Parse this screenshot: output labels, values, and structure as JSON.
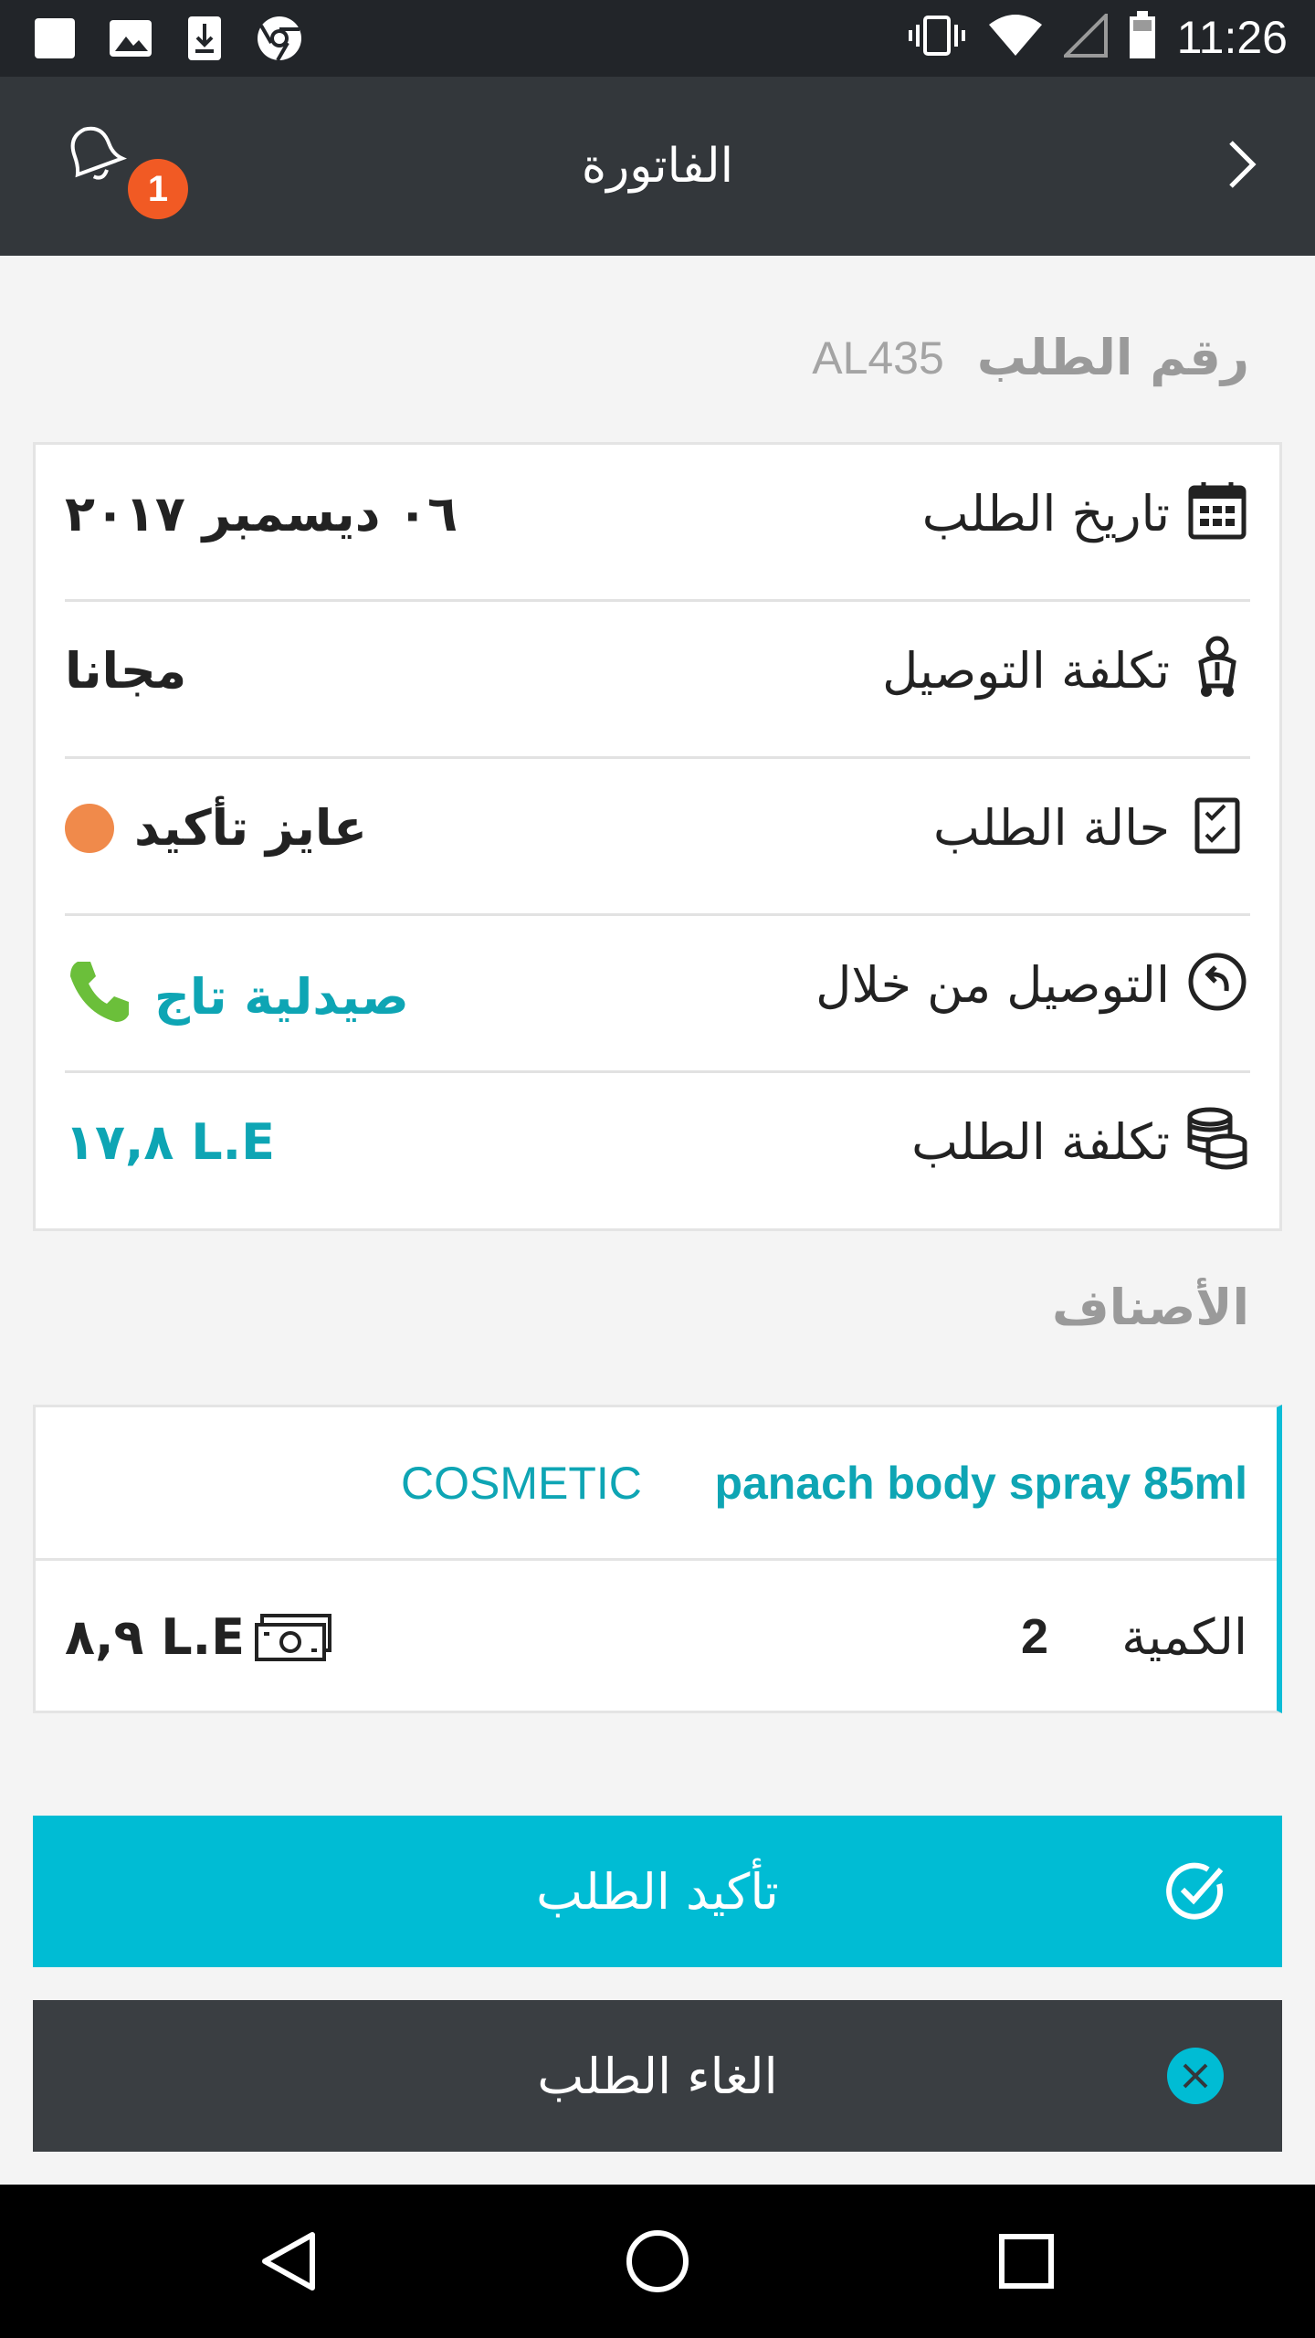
{
  "status_bar": {
    "time": "11:26",
    "icons": [
      "notification-square-icon",
      "image-icon",
      "download-icon",
      "chrome-icon",
      "vibrate-icon",
      "wifi-icon",
      "signal-icon",
      "battery-icon"
    ]
  },
  "app_bar": {
    "title": "الفاتورة",
    "notification_count": "1",
    "back_icon": "chevron-right-icon",
    "bell_icon": "bell-icon"
  },
  "order": {
    "number_label": "رقم الطلب",
    "number_value": "AL435"
  },
  "details": [
    {
      "label": "تاريخ الطلب",
      "value": "٠٦ ديسمبر ٢٠١٧",
      "icon": "calendar-icon"
    },
    {
      "label": "تكلفة التوصيل",
      "value": "مجانا",
      "icon": "delivery-scooter-icon"
    },
    {
      "label": "حالة الطلب",
      "value": "عايز تأكيد",
      "icon": "checklist-icon",
      "status_color": "#f08a4b"
    },
    {
      "label": "التوصيل من خلال",
      "value": "صيدلية تاج",
      "icon": "return-arrow-icon",
      "phone_icon": "phone-icon",
      "phone_color": "#6bbf3a"
    },
    {
      "label": "تكلفة الطلب",
      "value": "L.E ١٧,٨",
      "icon": "coins-stack-icon"
    }
  ],
  "items_section": {
    "title": "الأصناف",
    "items": [
      {
        "name": "panach body spray 85ml",
        "category": "COSMETIC",
        "qty_label": "الكمية",
        "qty": "2",
        "price": "L.E ٨,٩",
        "price_icon": "banknote-icon"
      }
    ]
  },
  "actions": {
    "confirm_label": "تأكيد الطلب",
    "confirm_icon": "check-circle-icon",
    "cancel_label": "الغاء الطلب",
    "cancel_icon": "close-circle-icon"
  },
  "colors": {
    "accent": "#00bcd4",
    "teal_text": "#0ea5b4",
    "header_bg": "#33373b",
    "badge": "#f15a24"
  },
  "nav_bar": {
    "icons": [
      "back-triangle-icon",
      "home-circle-icon",
      "recents-square-icon"
    ]
  }
}
